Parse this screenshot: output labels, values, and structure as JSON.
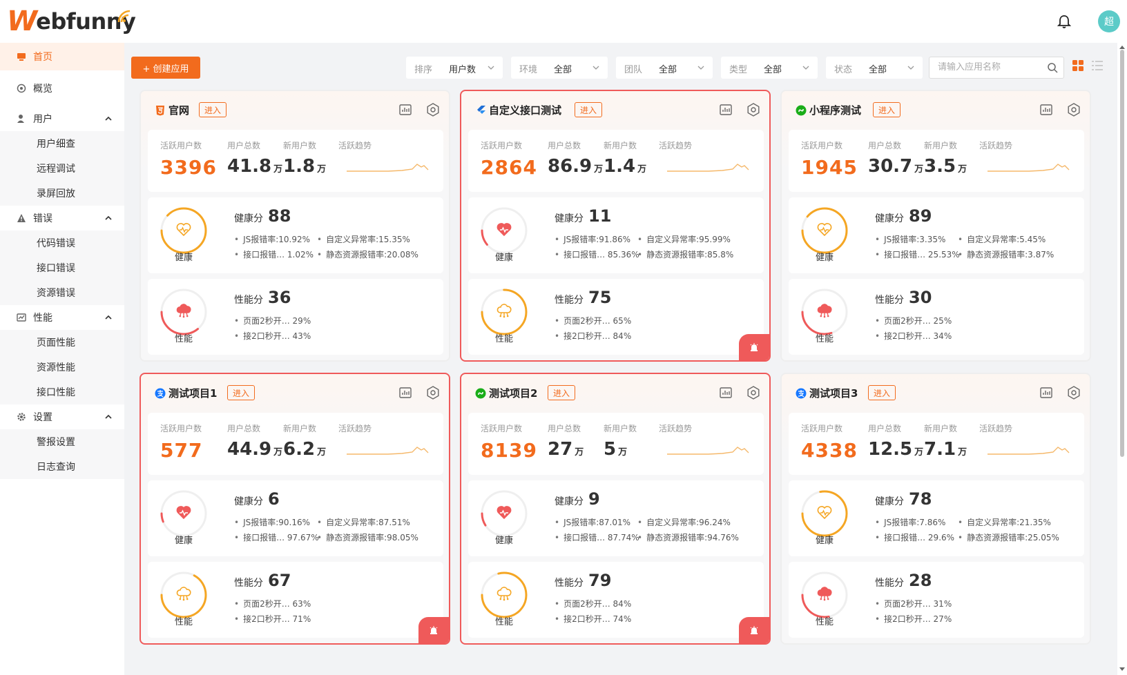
{
  "header": {
    "logo_w": "W",
    "logo_rest": "ebfunny",
    "avatar_text": "超"
  },
  "sidebar": {
    "items": [
      {
        "label": "首页",
        "icon": "home-icon",
        "active": true
      },
      {
        "label": "概览",
        "icon": "overview-icon"
      },
      {
        "label": "用户",
        "icon": "user-icon",
        "expandable": true,
        "children": [
          "用户细查",
          "远程调试",
          "录屏回放"
        ]
      },
      {
        "label": "错误",
        "icon": "warning-icon",
        "expandable": true,
        "children": [
          "代码错误",
          "接口错误",
          "资源错误"
        ]
      },
      {
        "label": "性能",
        "icon": "performance-icon",
        "expandable": true,
        "children": [
          "页面性能",
          "资源性能",
          "接口性能"
        ]
      },
      {
        "label": "设置",
        "icon": "gear-icon",
        "expandable": true,
        "children": [
          "警报设置",
          "日志查询"
        ]
      }
    ]
  },
  "toolbar": {
    "create_label": "+ 创建应用",
    "filters": [
      {
        "label": "排序",
        "value": "用户数"
      },
      {
        "label": "环境",
        "value": "全部"
      },
      {
        "label": "团队",
        "value": "全部"
      },
      {
        "label": "类型",
        "value": "全部"
      },
      {
        "label": "状态",
        "value": "全部"
      }
    ],
    "search_placeholder": "请输入应用名称"
  },
  "labels": {
    "enter": "进入",
    "active_users": "活跃用户数",
    "total_users": "用户总数",
    "new_users": "新用户数",
    "trend": "活跃趋势",
    "unit": "万",
    "health": "健康",
    "health_score": "健康分",
    "perf": "性能",
    "perf_score": "性能分",
    "js_err": "JS报错率:",
    "custom_err": "自定义异常率:",
    "api_err": "接口报错…",
    "res_err": "静态资源报错率:",
    "page_2s": "页面2秒开…",
    "api_2s": "接2口秒开…"
  },
  "projects": [
    {
      "name": "官网",
      "icon": "html5-icon",
      "icon_color": "#f26b1d",
      "alert": false,
      "active": "3396",
      "total": "41.8",
      "new": "1.8",
      "health": "88",
      "health_level": 0.88,
      "js": "10.92%",
      "custom": "15.35%",
      "api": "1.02%",
      "res": "20.08%",
      "perf": "36",
      "perf_level": 0.36,
      "page2s": "29%",
      "api2s": "43%"
    },
    {
      "name": "自定义接口测试",
      "icon": "flutter-icon",
      "icon_color": "#1f6fd6",
      "alert": true,
      "active": "2864",
      "total": "86.9",
      "new": "1.4",
      "health": "11",
      "health_level": 0.11,
      "js": "91.86%",
      "custom": "95.99%",
      "api": "85.36%",
      "res": "85.8%",
      "perf": "75",
      "perf_level": 0.75,
      "page2s": "65%",
      "api2s": "84%"
    },
    {
      "name": "小程序测试",
      "icon": "miniprogram-icon",
      "icon_color": "#1aad19",
      "alert": false,
      "active": "1945",
      "total": "30.7",
      "new": "3.5",
      "health": "89",
      "health_level": 0.89,
      "js": "3.35%",
      "custom": "5.45%",
      "api": "25.53%",
      "res": "3.87%",
      "perf": "30",
      "perf_level": 0.3,
      "page2s": "25%",
      "api2s": "34%"
    },
    {
      "name": "测试项目1",
      "icon": "alipay-icon",
      "icon_color": "#1677ff",
      "alert": true,
      "active": "577",
      "total": "44.9",
      "new": "6.2",
      "health": "6",
      "health_level": 0.06,
      "js": "90.16%",
      "custom": "87.51%",
      "api": "97.67%",
      "res": "98.05%",
      "perf": "67",
      "perf_level": 0.67,
      "page2s": "63%",
      "api2s": "71%"
    },
    {
      "name": "测试项目2",
      "icon": "miniprogram-icon",
      "icon_color": "#1aad19",
      "alert": true,
      "active": "8139",
      "total": "27",
      "new": "5",
      "health": "9",
      "health_level": 0.09,
      "js": "87.01%",
      "custom": "96.24%",
      "api": "87.74%",
      "res": "94.76%",
      "perf": "79",
      "perf_level": 0.79,
      "page2s": "84%",
      "api2s": "74%"
    },
    {
      "name": "测试项目3",
      "icon": "alipay-icon",
      "icon_color": "#1677ff",
      "alert": false,
      "active": "4338",
      "total": "12.5",
      "new": "7.1",
      "health": "78",
      "health_level": 0.78,
      "js": "7.86%",
      "custom": "21.35%",
      "api": "29.6%",
      "res": "25.05%",
      "perf": "28",
      "perf_level": 0.28,
      "page2s": "31%",
      "api2s": "27%"
    }
  ],
  "colors": {
    "accent": "#f26b1d",
    "alert": "#ef5a5a",
    "good": "#f5a623",
    "bad": "#ef5a5a"
  }
}
